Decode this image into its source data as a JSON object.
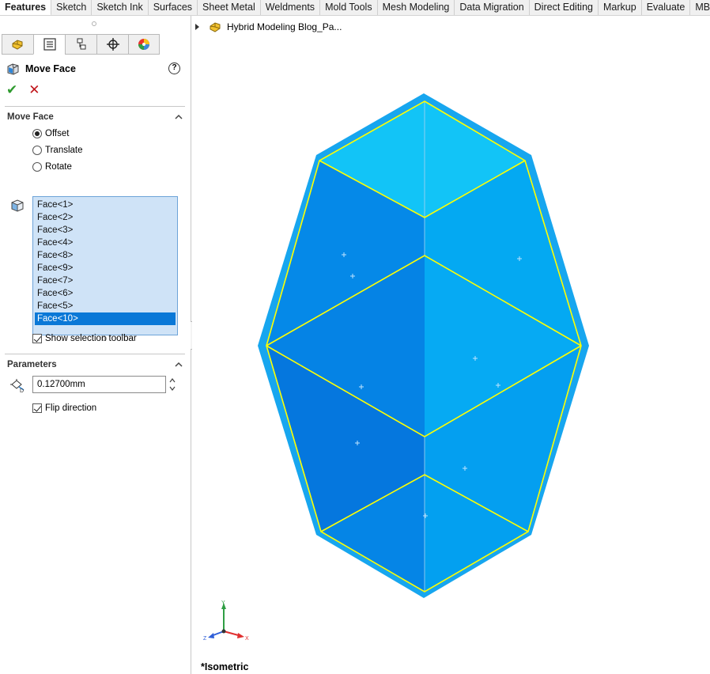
{
  "tabs": [
    "Features",
    "Sketch",
    "Sketch Ink",
    "Surfaces",
    "Sheet Metal",
    "Weldments",
    "Mold Tools",
    "Mesh Modeling",
    "Data Migration",
    "Direct Editing",
    "Markup",
    "Evaluate",
    "MB"
  ],
  "active_tab": "Features",
  "manager_tabs": [
    {
      "icon": "feature-manager-icon"
    },
    {
      "icon": "property-manager-icon",
      "active": true
    },
    {
      "icon": "configuration-manager-icon"
    },
    {
      "icon": "dimxpert-manager-icon"
    },
    {
      "icon": "display-manager-icon"
    }
  ],
  "property_manager": {
    "title": "Move Face",
    "help": "?",
    "ok": "✔",
    "cancel": "✕"
  },
  "move_face_section": {
    "title": "Move Face",
    "options": [
      {
        "label": "Offset",
        "selected": true
      },
      {
        "label": "Translate",
        "selected": false
      },
      {
        "label": "Rotate",
        "selected": false
      }
    ],
    "faces": [
      "Face<1>",
      "Face<2>",
      "Face<3>",
      "Face<4>",
      "Face<8>",
      "Face<9>",
      "Face<7>",
      "Face<6>",
      "Face<5>",
      "Face<10>"
    ],
    "selected_face": "Face<10>",
    "show_selection_toolbar": {
      "label": "Show selection toolbar",
      "checked": true
    }
  },
  "parameters_section": {
    "title": "Parameters",
    "distance": "0.12700mm",
    "flip_direction": {
      "label": "Flip direction",
      "checked": true
    }
  },
  "graphics": {
    "tree_item": "Hybrid Modeling Blog_Pa...",
    "view_name": "*Isometric",
    "triad": {
      "x": "X",
      "y": "Y",
      "z": "Z"
    }
  },
  "colors": {
    "face_light": "#12c4f7",
    "face_mid": "#04a9f2",
    "face_dark": "#0589e8",
    "face_deep": "#0577de",
    "highlight_edge": "#ffff00",
    "list_bg": "#cfe3f7",
    "list_sel": "#0a78d7"
  }
}
